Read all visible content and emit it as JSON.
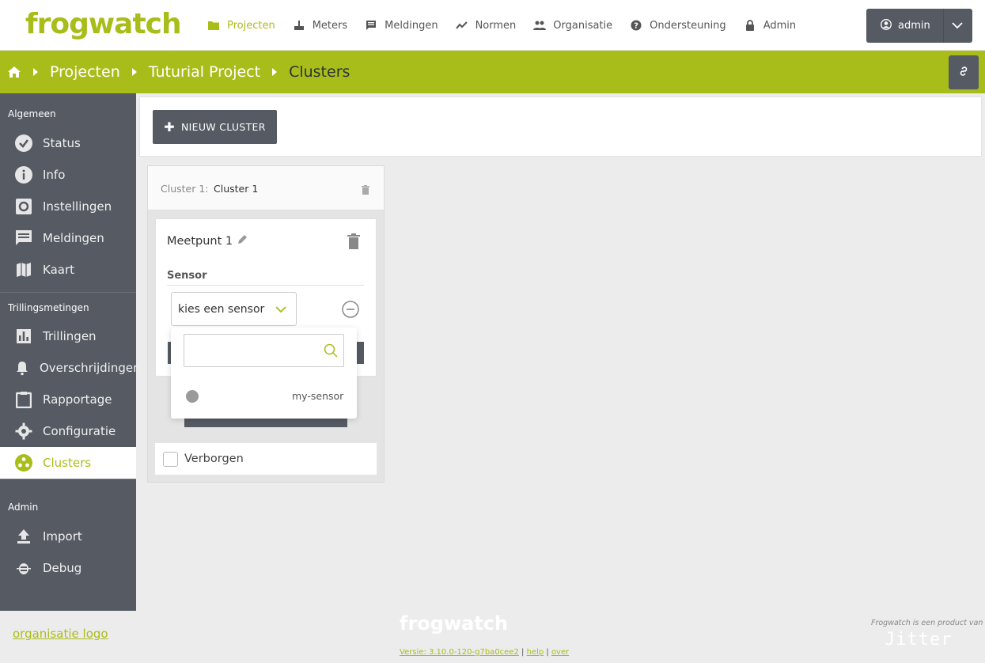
{
  "brand": {
    "logo_text": "frogwatch",
    "accent": "#a9bd1a",
    "dark": "#555a63"
  },
  "nav": {
    "items": [
      {
        "label": "Projecten",
        "icon": "folder-icon",
        "active": true
      },
      {
        "label": "Meters",
        "icon": "router-icon"
      },
      {
        "label": "Meldingen",
        "icon": "message-icon"
      },
      {
        "label": "Normen",
        "icon": "trend-icon"
      },
      {
        "label": "Organisatie",
        "icon": "people-icon"
      },
      {
        "label": "Ondersteuning",
        "icon": "help-icon"
      },
      {
        "label": "Admin",
        "icon": "lock-icon"
      }
    ],
    "user": "admin"
  },
  "breadcrumb": [
    "Projecten",
    "Tuturial Project",
    "Clusters"
  ],
  "sidebar": {
    "groups": [
      {
        "title": "Algemeen",
        "items": [
          {
            "label": "Status",
            "icon": "check-circle-icon"
          },
          {
            "label": "Info",
            "icon": "info-icon"
          },
          {
            "label": "Instellingen",
            "icon": "settings-icon"
          },
          {
            "label": "Meldingen",
            "icon": "message-icon"
          },
          {
            "label": "Kaart",
            "icon": "map-icon"
          }
        ]
      },
      {
        "title": "Trillingsmetingen",
        "items": [
          {
            "label": "Trillingen",
            "icon": "bar-chart-icon"
          },
          {
            "label": "Overschrijdingen",
            "icon": "bell-icon"
          },
          {
            "label": "Rapportage",
            "icon": "clipboard-icon"
          },
          {
            "label": "Configuratie",
            "icon": "gear-icon"
          },
          {
            "label": "Clusters",
            "icon": "cluster-icon",
            "active": true
          }
        ]
      },
      {
        "title": "Admin",
        "items": [
          {
            "label": "Import",
            "icon": "upload-icon"
          },
          {
            "label": "Debug",
            "icon": "bug-icon"
          }
        ]
      }
    ]
  },
  "toolbar": {
    "new_cluster_label": "NIEUW CLUSTER"
  },
  "cluster": {
    "label": "Cluster 1:",
    "name": "Cluster 1",
    "measurepoint": {
      "title": "Meetpunt 1",
      "sensor_label": "Sensor",
      "select_placeholder": "kies een sensor",
      "options": [
        "my-sensor"
      ]
    },
    "hidden_label": "Verborgen"
  },
  "footer": {
    "org_logo": "organisatie logo",
    "logo_text": "frogwatch",
    "version": "Versie: 3.10.0-120-g7ba0cee2",
    "help": "help",
    "about": "over",
    "product_of": "Frogwatch is een product van",
    "jitter": "Jitter"
  }
}
